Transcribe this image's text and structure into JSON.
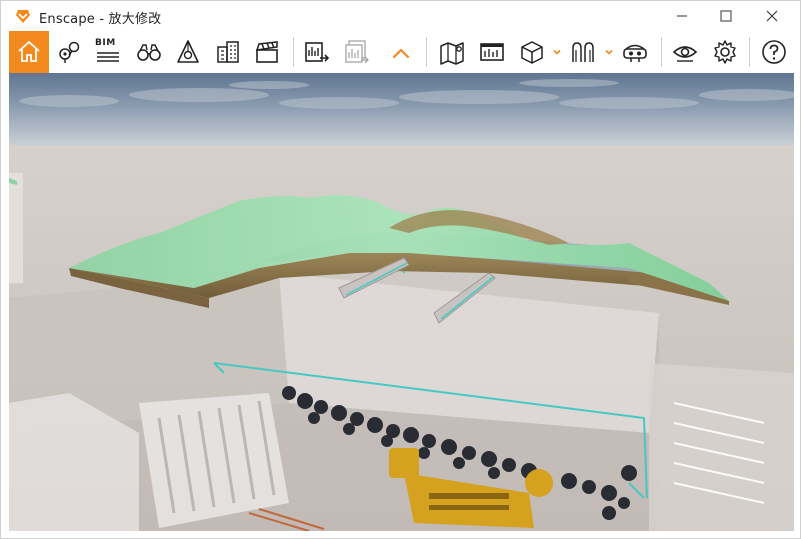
{
  "window": {
    "title": "Enscape - 放大修改",
    "accent": "#f28a1e"
  },
  "toolbar": {
    "items": [
      {
        "name": "home",
        "icon": "home-icon",
        "active": true
      },
      {
        "name": "location-pins",
        "icon": "map-pins-icon"
      },
      {
        "name": "bim",
        "icon": "bim-icon",
        "label": "BIM"
      },
      {
        "name": "walk-mode",
        "icon": "binoculars-icon"
      },
      {
        "name": "perspective",
        "icon": "perspective-icon"
      },
      {
        "name": "buildings",
        "icon": "buildings-icon"
      },
      {
        "name": "video-editor",
        "icon": "clapperboard-icon"
      },
      {
        "name": "export-screenshot",
        "icon": "export-icon"
      },
      {
        "name": "batch-render",
        "icon": "batch-export-icon"
      },
      {
        "name": "collapse-toolbar",
        "icon": "chevron-up-icon"
      },
      {
        "name": "map",
        "icon": "map-icon"
      },
      {
        "name": "panorama",
        "icon": "panorama-icon"
      },
      {
        "name": "asset-library",
        "icon": "cube-icon"
      },
      {
        "name": "vr",
        "icon": "vr-icon"
      },
      {
        "name": "vr-headset",
        "icon": "headset-icon"
      },
      {
        "name": "visual-settings",
        "icon": "eye-icon"
      },
      {
        "name": "general-settings",
        "icon": "gear-icon"
      },
      {
        "name": "help",
        "icon": "help-icon"
      }
    ]
  },
  "viewport": {
    "scene": "3D render viewport"
  }
}
